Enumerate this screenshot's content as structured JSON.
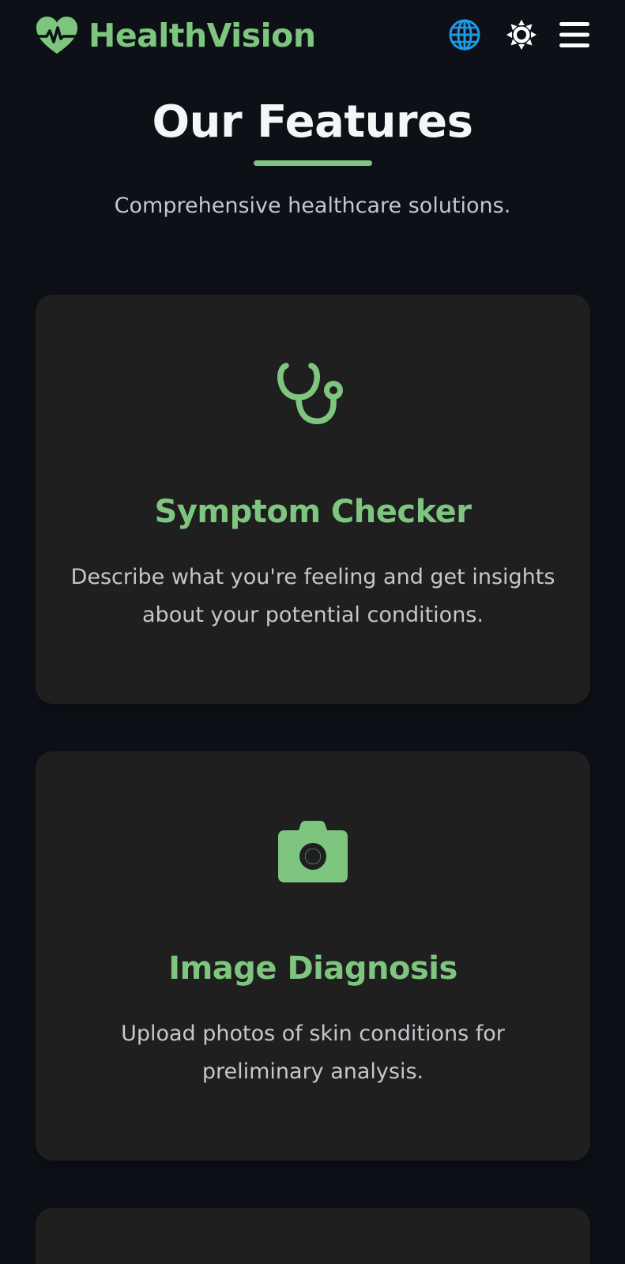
{
  "header": {
    "brand_name": "HealthVision",
    "brand_icon": "heart-pulse-icon",
    "language_icon": "globe-icon",
    "theme_icon": "sun-icon",
    "menu_icon": "hamburger-menu-icon"
  },
  "section": {
    "title": "Our Features",
    "subtitle": "Comprehensive healthcare solutions."
  },
  "features": [
    {
      "icon": "stethoscope-icon",
      "title": "Symptom Checker",
      "description": "Describe what you're feeling and get insights about your potential conditions."
    },
    {
      "icon": "camera-icon",
      "title": "Image Diagnosis",
      "description": "Upload photos of skin conditions for preliminary analysis."
    }
  ],
  "colors": {
    "background": "#0d1117",
    "card": "#1f1f1f",
    "accent": "#7ec67f",
    "globe": "#1e9be8"
  }
}
